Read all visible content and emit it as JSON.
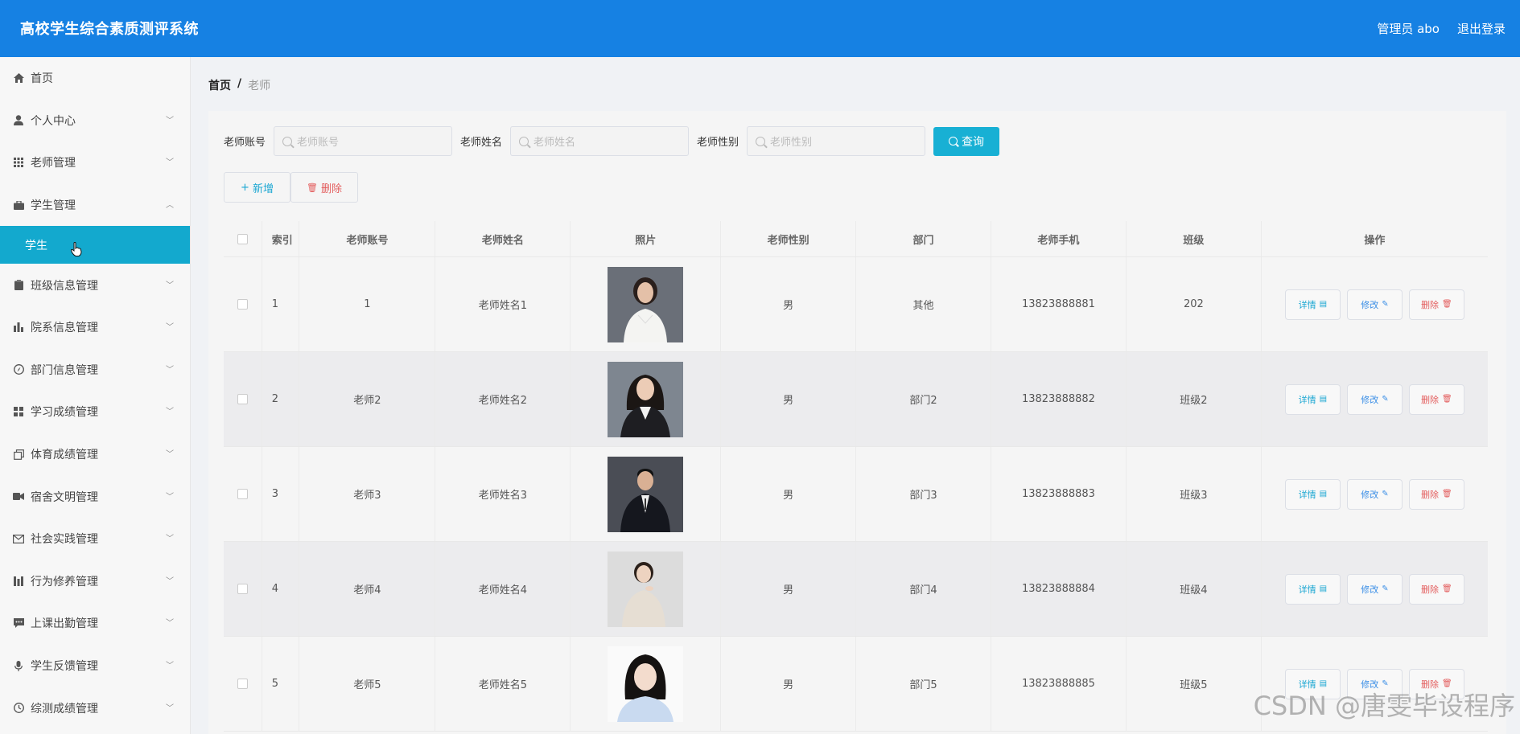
{
  "header": {
    "title": "高校学生综合素质测评系统",
    "user": "管理员 abo",
    "logout": "退出登录"
  },
  "sidebar": {
    "items": [
      {
        "label": "首页",
        "icon": "home-icon"
      },
      {
        "label": "个人中心",
        "icon": "user-icon"
      },
      {
        "label": "老师管理",
        "icon": "grid-icon"
      },
      {
        "label": "学生管理",
        "icon": "briefcase-icon"
      },
      {
        "label": "班级信息管理",
        "icon": "clipboard-icon"
      },
      {
        "label": "院系信息管理",
        "icon": "bar-chart-icon"
      },
      {
        "label": "部门信息管理",
        "icon": "compass-icon"
      },
      {
        "label": "学习成绩管理",
        "icon": "apps-icon"
      },
      {
        "label": "体育成绩管理",
        "icon": "copy-icon"
      },
      {
        "label": "宿舍文明管理",
        "icon": "video-icon"
      },
      {
        "label": "社会实践管理",
        "icon": "mail-icon"
      },
      {
        "label": "行为修养管理",
        "icon": "columns-icon"
      },
      {
        "label": "上课出勤管理",
        "icon": "chat-icon"
      },
      {
        "label": "学生反馈管理",
        "icon": "mic-icon"
      },
      {
        "label": "综测成绩管理",
        "icon": "clock-icon"
      }
    ],
    "sub_item": "学生"
  },
  "breadcrumb": {
    "home": "首页",
    "sep": "/",
    "current": "老师"
  },
  "search": {
    "account_label": "老师账号",
    "account_placeholder": "老师账号",
    "name_label": "老师姓名",
    "name_placeholder": "老师姓名",
    "gender_label": "老师性别",
    "gender_placeholder": "老师性别",
    "query": "查询"
  },
  "actions": {
    "add": "新增",
    "delete": "删除"
  },
  "table": {
    "headers": [
      "索引",
      "老师账号",
      "老师姓名",
      "照片",
      "老师性别",
      "部门",
      "老师手机",
      "班级",
      "操作"
    ],
    "rows": [
      {
        "idx": "1",
        "account": "1",
        "name": "老师姓名1",
        "gender": "男",
        "dept": "其他",
        "phone": "13823888881",
        "class": "202"
      },
      {
        "idx": "2",
        "account": "老师2",
        "name": "老师姓名2",
        "gender": "男",
        "dept": "部门2",
        "phone": "13823888882",
        "class": "班级2"
      },
      {
        "idx": "3",
        "account": "老师3",
        "name": "老师姓名3",
        "gender": "男",
        "dept": "部门3",
        "phone": "13823888883",
        "class": "班级3"
      },
      {
        "idx": "4",
        "account": "老师4",
        "name": "老师姓名4",
        "gender": "男",
        "dept": "部门4",
        "phone": "13823888884",
        "class": "班级4"
      },
      {
        "idx": "5",
        "account": "老师5",
        "name": "老师姓名5",
        "gender": "男",
        "dept": "部门5",
        "phone": "13823888885",
        "class": "班级5"
      }
    ],
    "op_detail": "详情",
    "op_edit": "修改",
    "op_delete": "删除"
  },
  "watermark": "CSDN @唐雯毕设程序",
  "colors": {
    "header": "#1681e3",
    "accent": "#13a9ce",
    "danger": "#e35d5d"
  }
}
